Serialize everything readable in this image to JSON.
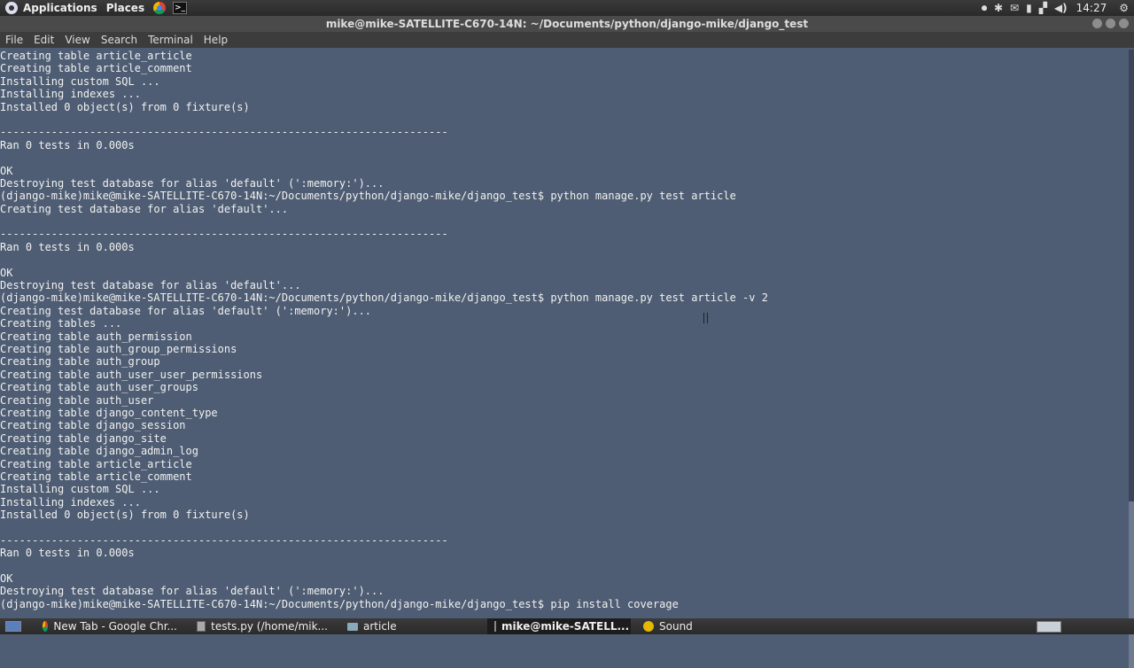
{
  "top_panel": {
    "applications": "Applications",
    "places": "Places",
    "clock": "14:27"
  },
  "window": {
    "title": "mike@mike-SATELLITE-C670-14N: ~/Documents/python/django-mike/django_test"
  },
  "menu": [
    "File",
    "Edit",
    "View",
    "Search",
    "Terminal",
    "Help"
  ],
  "terminal": {
    "lines": [
      "Creating table article_article",
      "Creating table article_comment",
      "Installing custom SQL ...",
      "Installing indexes ...",
      "Installed 0 object(s) from 0 fixture(s)",
      "",
      "----------------------------------------------------------------------",
      "Ran 0 tests in 0.000s",
      "",
      "OK",
      "Destroying test database for alias 'default' (':memory:')...",
      "(django-mike)mike@mike-SATELLITE-C670-14N:~/Documents/python/django-mike/django_test$ python manage.py test article",
      "Creating test database for alias 'default'...",
      "",
      "----------------------------------------------------------------------",
      "Ran 0 tests in 0.000s",
      "",
      "OK",
      "Destroying test database for alias 'default'...",
      "(django-mike)mike@mike-SATELLITE-C670-14N:~/Documents/python/django-mike/django_test$ python manage.py test article -v 2",
      "Creating test database for alias 'default' (':memory:')...",
      "Creating tables ...",
      "Creating table auth_permission",
      "Creating table auth_group_permissions",
      "Creating table auth_group",
      "Creating table auth_user_user_permissions",
      "Creating table auth_user_groups",
      "Creating table auth_user",
      "Creating table django_content_type",
      "Creating table django_session",
      "Creating table django_site",
      "Creating table django_admin_log",
      "Creating table article_article",
      "Creating table article_comment",
      "Installing custom SQL ...",
      "Installing indexes ...",
      "Installed 0 object(s) from 0 fixture(s)",
      "",
      "----------------------------------------------------------------------",
      "Ran 0 tests in 0.000s",
      "",
      "OK",
      "Destroying test database for alias 'default' (':memory:')...",
      "(django-mike)mike@mike-SATELLITE-C670-14N:~/Documents/python/django-mike/django_test$ pip install coverage"
    ]
  },
  "taskbar": {
    "tasks": [
      {
        "label": "New Tab - Google Chr...",
        "icon": "chrome-icon",
        "active": false
      },
      {
        "label": "tests.py (/home/mik...",
        "icon": "text-editor-icon",
        "active": false
      },
      {
        "label": "article",
        "icon": "folder-icon",
        "active": false
      },
      {
        "label": "mike@mike-SATELL...",
        "icon": "terminal-icon",
        "active": true
      },
      {
        "label": "Sound",
        "icon": "sound-icon",
        "active": false
      }
    ]
  },
  "colors": {
    "terminal_bg": "#4e5d73",
    "terminal_fg": "#f1f1f1",
    "panel_bg": "#2e2e2e"
  }
}
